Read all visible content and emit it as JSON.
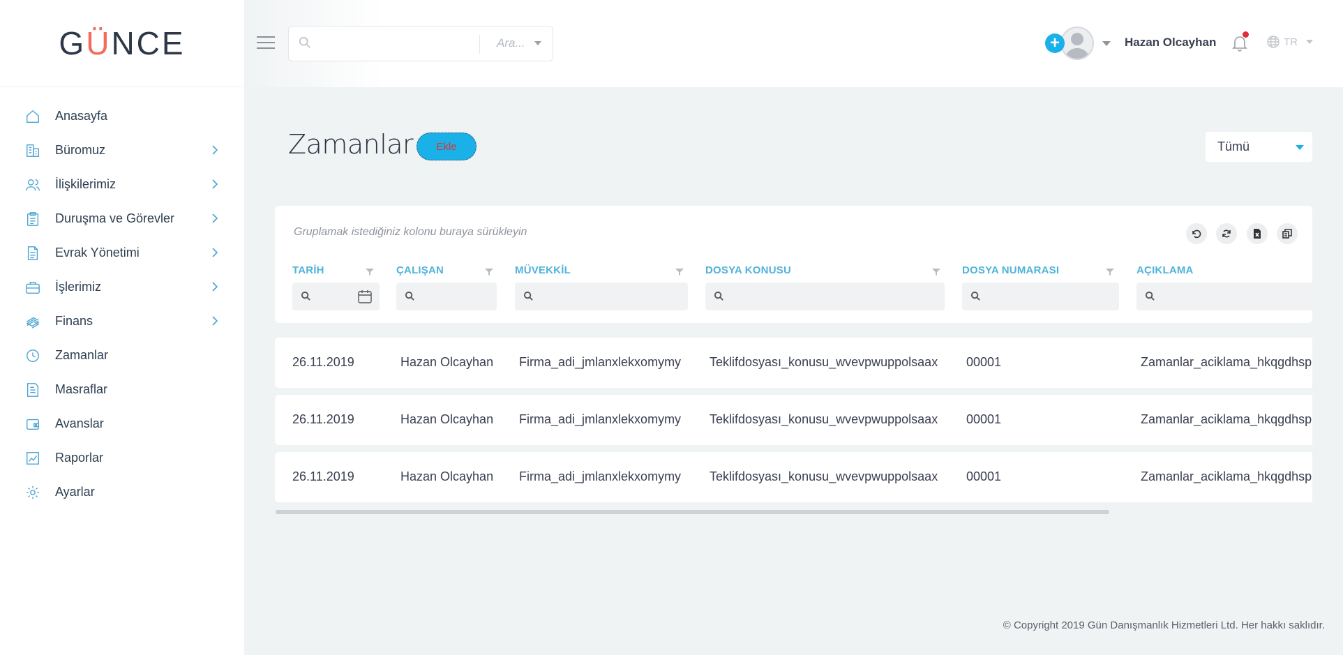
{
  "brand": {
    "logo_pre": "G",
    "logo_accent": "Ü",
    "logo_post": "NCE"
  },
  "sidebar": {
    "items": [
      {
        "label": "Anasayfa",
        "icon": "home-icon",
        "has_children": false
      },
      {
        "label": "Büromuz",
        "icon": "building-icon",
        "has_children": true
      },
      {
        "label": "İlişkilerimiz",
        "icon": "users-icon",
        "has_children": true
      },
      {
        "label": "Duruşma ve Görevler",
        "icon": "clipboard-icon",
        "has_children": true
      },
      {
        "label": "Evrak Yönetimi",
        "icon": "document-icon",
        "has_children": true
      },
      {
        "label": "İşlerimiz",
        "icon": "briefcase-icon",
        "has_children": true
      },
      {
        "label": "Finans",
        "icon": "money-icon",
        "has_children": true
      },
      {
        "label": "Zamanlar",
        "icon": "clock-icon",
        "has_children": false
      },
      {
        "label": "Masraflar",
        "icon": "receipt-icon",
        "has_children": false
      },
      {
        "label": "Avanslar",
        "icon": "wallet-icon",
        "has_children": false
      },
      {
        "label": "Raporlar",
        "icon": "chart-icon",
        "has_children": false
      },
      {
        "label": "Ayarlar",
        "icon": "gear-icon",
        "has_children": false
      }
    ]
  },
  "header": {
    "search": {
      "value": "",
      "placeholder": "",
      "scope": "Ara..."
    },
    "user_name": "Hazan Olcayhan",
    "language": "TR"
  },
  "page": {
    "title": "Zamanlar",
    "add_label": "Ekle",
    "filter_value": "Tümü"
  },
  "grid": {
    "group_hint": "Gruplamak istediğiniz kolonu buraya sürükleyin",
    "columns": [
      "TARİH",
      "ÇALIŞAN",
      "MÜVEKKİL",
      "DOSYA KONUSU",
      "DOSYA NUMARASI",
      "AÇIKLAMA"
    ],
    "rows": [
      [
        "26.11.2019",
        "Hazan Olcayhan",
        "Firma_adi_jmlanxlekxomymy",
        "Teklifdosyası_konusu_wvevpwuppolsaax",
        "00001",
        "Zamanlar_aciklama_hkqgdhsp"
      ],
      [
        "26.11.2019",
        "Hazan Olcayhan",
        "Firma_adi_jmlanxlekxomymy",
        "Teklifdosyası_konusu_wvevpwuppolsaax",
        "00001",
        "Zamanlar_aciklama_hkqgdhsp"
      ],
      [
        "26.11.2019",
        "Hazan Olcayhan",
        "Firma_adi_jmlanxlekxomymy",
        "Teklifdosyası_konusu_wvevpwuppolsaax",
        "00001",
        "Zamanlar_aciklama_hkqgdhsp"
      ]
    ]
  },
  "footer": {
    "copyright": "© Copyright 2019 Gün Danışmanlık Hizmetleri Ltd. Her hakkı saklıdır."
  },
  "colors": {
    "accent": "#1ab0e8",
    "column_header": "#4fb3d9",
    "nav_icon": "#4aa3d2",
    "logo_accent": "#f26b5b"
  }
}
